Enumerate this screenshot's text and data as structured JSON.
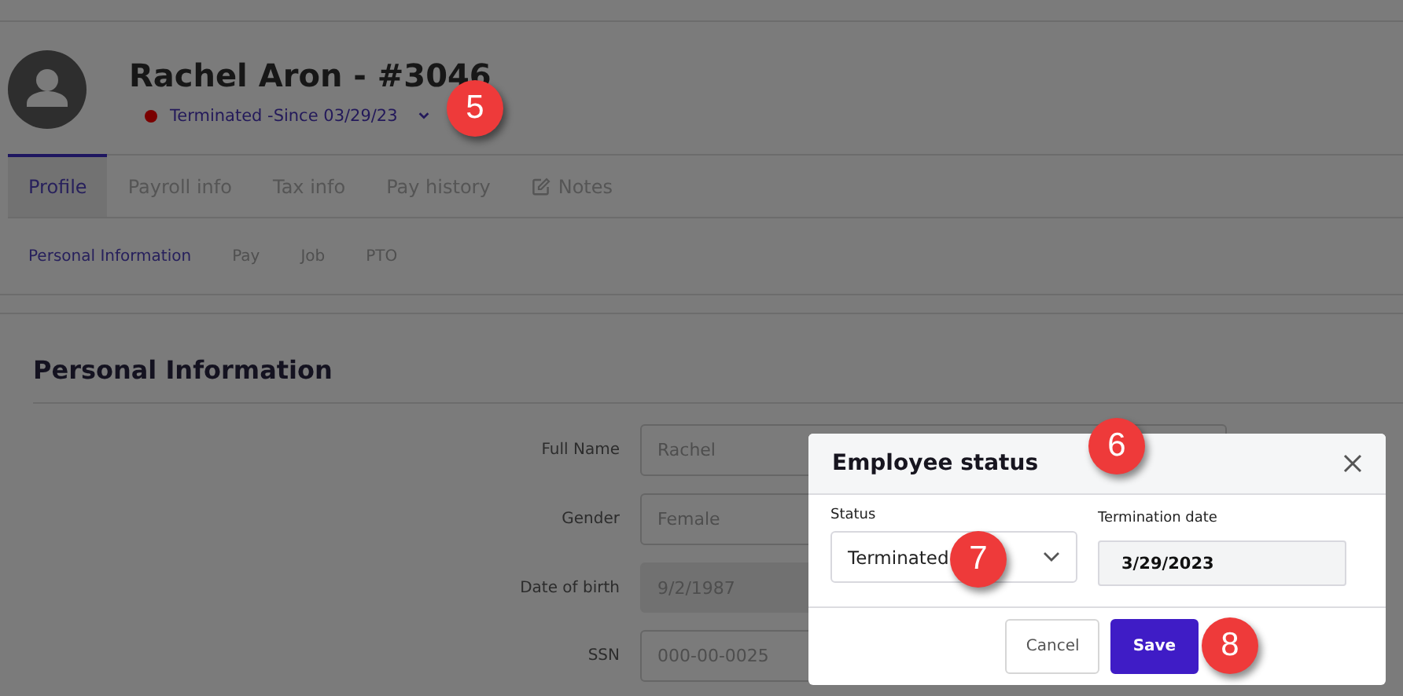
{
  "employee": {
    "name": "Rachel Aron - #3046",
    "status": {
      "label": "Terminated -Since 03/29/23",
      "color": "#7a0000"
    }
  },
  "tabs": [
    {
      "label": "Profile",
      "selected": true
    },
    {
      "label": "Payroll info",
      "selected": false
    },
    {
      "label": "Tax info",
      "selected": false
    },
    {
      "label": "Pay history",
      "selected": false
    },
    {
      "label": "Notes",
      "selected": false,
      "kind": "note"
    }
  ],
  "subtabs": [
    {
      "label": "Personal Information",
      "selected": true
    },
    {
      "label": "Pay",
      "selected": false
    },
    {
      "label": "Job",
      "selected": false
    },
    {
      "label": "PTO",
      "selected": false
    }
  ],
  "section": {
    "title": "Personal Information",
    "fields": [
      {
        "label": "Full Name",
        "value": "Rachel",
        "disabled": false
      },
      {
        "label": "Gender",
        "value": "Female",
        "disabled": false
      },
      {
        "label": "Date of birth",
        "value": "9/2/1987",
        "disabled": true
      },
      {
        "label": "SSN",
        "value": "000-00-0025",
        "disabled": false
      }
    ]
  },
  "dialog": {
    "title": "Employee status",
    "status_label": "Status",
    "status_value": "Terminated",
    "date_label": "Termination date",
    "date_value": "3/29/2023",
    "buttons": [
      {
        "label": "Cancel",
        "kind": "secondary"
      },
      {
        "label": "Save",
        "kind": "primary"
      }
    ]
  },
  "callouts": [
    "5",
    "6",
    "7",
    "8"
  ]
}
